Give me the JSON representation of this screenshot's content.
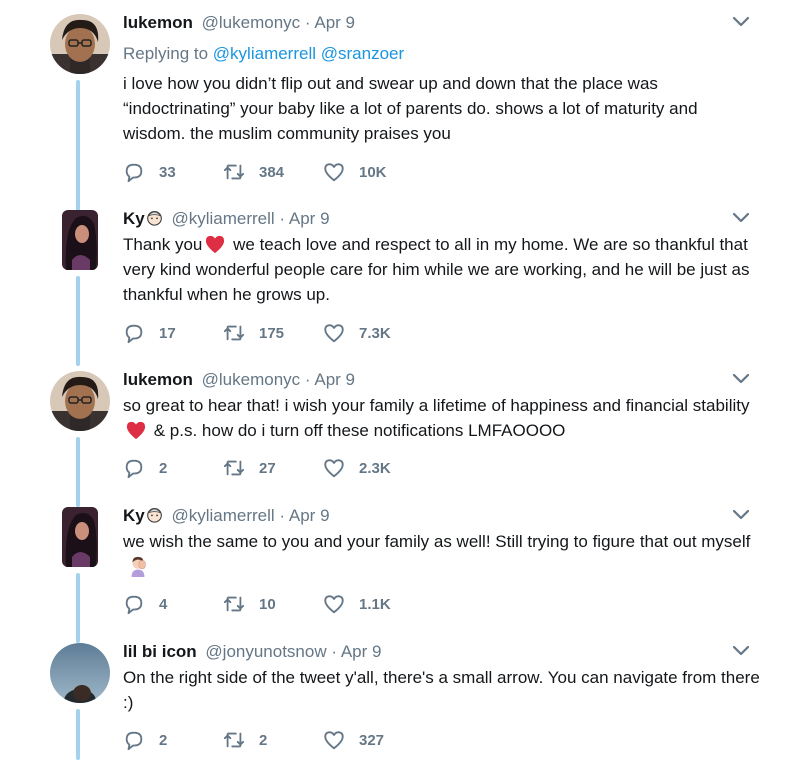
{
  "colors": {
    "text": "#14171a",
    "secondary": "#657786",
    "mention": "#1b95e0",
    "thread_line": "#a3d2f0",
    "heart": "#e0245e"
  },
  "tweets": [
    {
      "name": "lukemon",
      "handle": "@lukemonyc",
      "dot": "·",
      "date": "Apr 9",
      "replying_label": "Replying to",
      "mention_1": "@kyliamerrell",
      "mention_2": "@sranzoer",
      "text": "i love how you didn’t flip out and swear up and down that the place was “indoctrinating” your baby like a lot of parents do. shows a lot of maturity and wisdom. the muslim community praises you",
      "replies": "33",
      "retweets": "384",
      "likes": "10K",
      "avatar_icon": "user-avatar-icon"
    },
    {
      "name": "Ky",
      "handle": "@kyliamerrell",
      "dot": "·",
      "date": "Apr 9",
      "text_part1": "Thank you",
      "text_part2": "we teach love and respect to all in my home. We are so thankful that very kind wonderful people care for him while we are working, and he will be just as thankful when he grows up.",
      "replies": "17",
      "retweets": "175",
      "likes": "7.3K",
      "avatar_icon": "user-avatar-icon"
    },
    {
      "name": "lukemon",
      "handle": "@lukemonyc",
      "dot": "·",
      "date": "Apr 9",
      "text_part1": "so great to hear that! i wish your family a lifetime of happiness and financial stability",
      "text_part2": "& p.s. how do i turn off these notifications LMFAOOOO",
      "replies": "2",
      "retweets": "27",
      "likes": "2.3K",
      "avatar_icon": "user-avatar-icon"
    },
    {
      "name": "Ky",
      "handle": "@kyliamerrell",
      "dot": "·",
      "date": "Apr 9",
      "text": "we wish the same to you and your family as well! Still trying to figure that out myself",
      "replies": "4",
      "retweets": "10",
      "likes": "1.1K",
      "avatar_icon": "user-avatar-icon"
    },
    {
      "name": "lil bi icon",
      "handle": "@jonyunotsnow",
      "dot": "·",
      "date": "Apr 9",
      "text": "On the right side of the tweet y'all, there's a small arrow. You can navigate from there :)",
      "replies": "2",
      "retweets": "2",
      "likes": "327",
      "avatar_icon": "user-avatar-icon"
    }
  ]
}
